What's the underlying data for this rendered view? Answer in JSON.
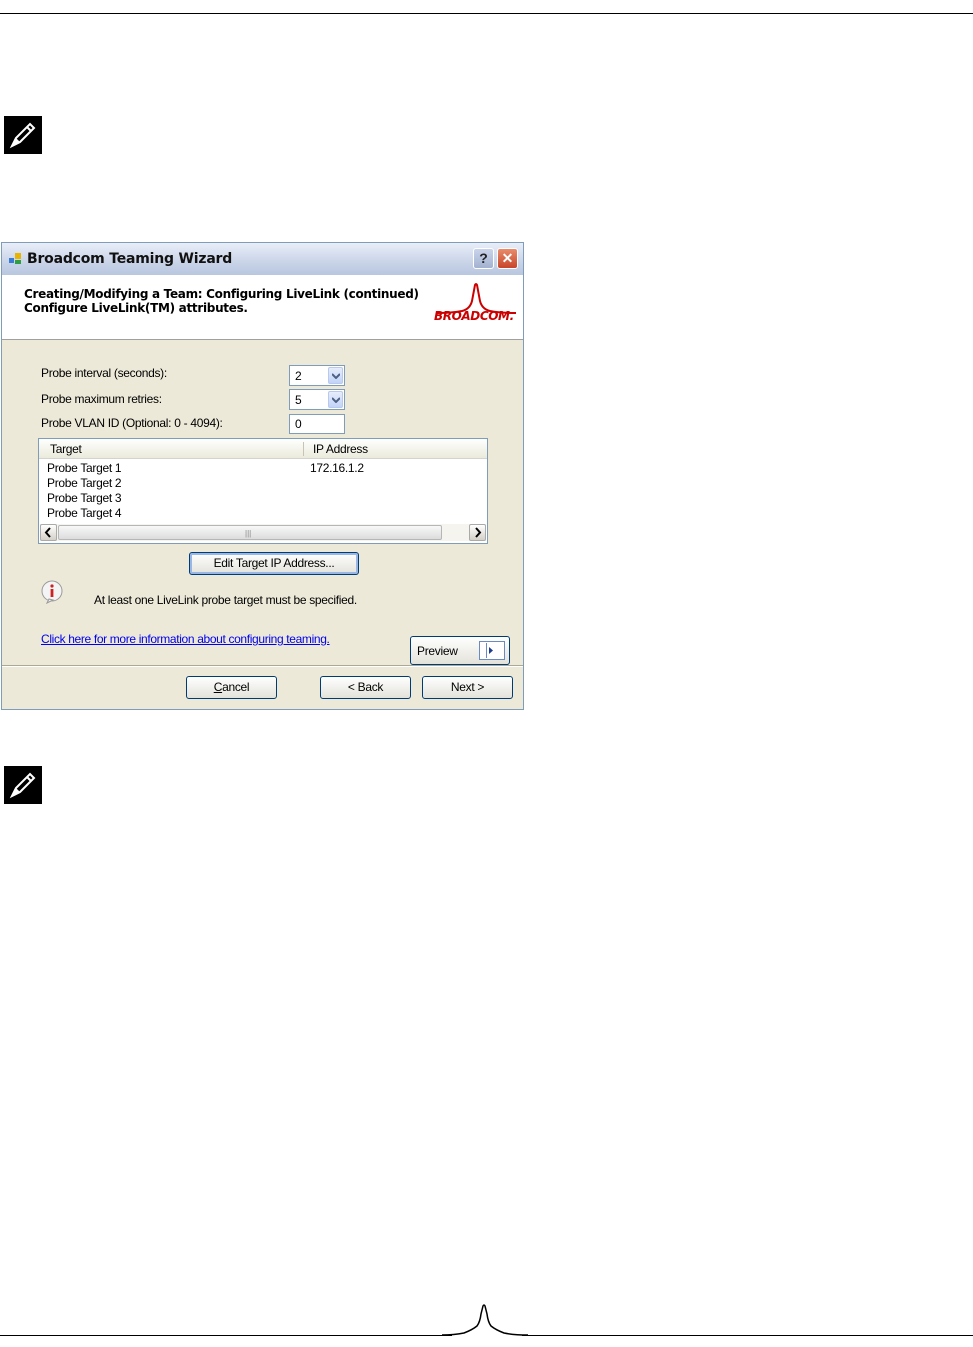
{
  "dialog": {
    "title": "Broadcom Teaming Wizard",
    "help_button": "?",
    "close_button": "✕",
    "header_line1": "Creating/Modifying a Team:  Configuring LiveLink (continued)",
    "header_line2": "Configure LiveLink(TM) attributes.",
    "logo_text": "BROADCOM.",
    "fields": {
      "probe_interval_label": "Probe interval (seconds):",
      "probe_interval_value": "2",
      "probe_retries_label": "Probe maximum retries:",
      "probe_retries_value": "5",
      "probe_vlan_label": "Probe VLAN ID (Optional:  0 - 4094):",
      "probe_vlan_value": "0"
    },
    "table": {
      "columns": [
        "Target",
        "IP Address"
      ],
      "rows": [
        {
          "target": "Probe Target 1",
          "ip": "172.16.1.2"
        },
        {
          "target": "Probe Target 2",
          "ip": ""
        },
        {
          "target": "Probe Target 3",
          "ip": ""
        },
        {
          "target": "Probe Target 4",
          "ip": ""
        }
      ]
    },
    "edit_button": "Edit Target IP Address...",
    "info_message": "At least one LiveLink probe target must be specified.",
    "help_link": "Click here for more information about configuring teaming.",
    "preview_button": "Preview",
    "cancel_button": "Cancel",
    "back_button": "< Back",
    "next_button": "Next >"
  },
  "colors": {
    "dialog_bg": "#ece9d8",
    "link": "#0000ee",
    "logo_red": "#cc0000"
  },
  "icons": [
    "note-pencil-icon",
    "app-icon",
    "info-icon",
    "dropdown-arrow-icon",
    "scroll-left-icon",
    "scroll-right-icon",
    "preview-icon"
  ]
}
